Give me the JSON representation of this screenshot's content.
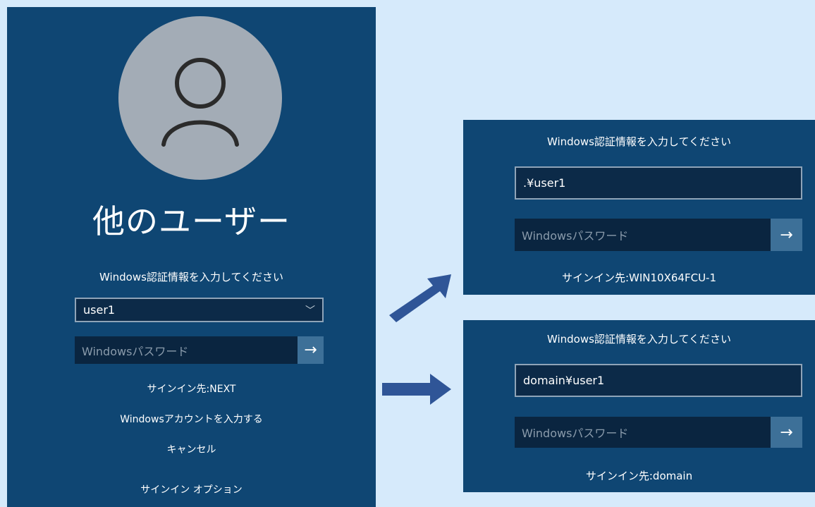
{
  "main": {
    "display_name": "他のユーザー",
    "prompt": "Windows認証情報を入力してください",
    "username_value": "user1",
    "password_placeholder": "Windowsパスワード",
    "submit_glyph": "→",
    "dropdown_glyph": "﹀",
    "sign_in_to": "サインイン先:NEXT",
    "windows_account_link": "Windowsアカウントを入力する",
    "cancel_link": "キャンセル",
    "sign_in_options_link": "サインイン オプション"
  },
  "local_panel": {
    "prompt": "Windows認証情報を入力してください",
    "username_value": ".¥user1",
    "password_placeholder": "Windowsパスワード",
    "submit_glyph": "→",
    "sign_in_to": "サインイン先:WIN10X64FCU-1"
  },
  "domain_panel": {
    "prompt": "Windows認証情報を入力してください",
    "username_value": "domain¥user1",
    "password_placeholder": "Windowsパスワード",
    "submit_glyph": "→",
    "sign_in_to": "サインイン先:domain"
  },
  "colors": {
    "background": "#d6eafb",
    "panel": "#0f4673",
    "arrow": "#2f5597",
    "avatar": "#a3acb6"
  },
  "icons": {
    "avatar": "user-silhouette-icon",
    "submit": "right-arrow-icon",
    "dropdown": "chevron-down-icon"
  }
}
